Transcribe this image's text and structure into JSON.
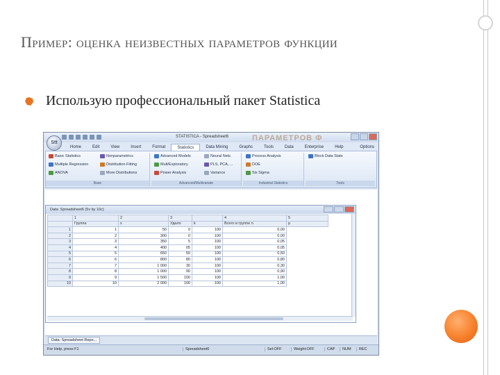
{
  "slide": {
    "title": "Пример: оценка неизвестных параметров функции",
    "bullet": "Использую профессиональный пакет Statistica"
  },
  "app": {
    "window_title": "STATISTICA - Spreadsheet6",
    "watermark": "ПАРАМЕТРОВ Ф",
    "orb_label": "Stt",
    "tabs": [
      "Home",
      "Edit",
      "View",
      "Insert",
      "Format",
      "Statistics",
      "Data Mining",
      "Graphs",
      "Tools",
      "Data",
      "Enterprise",
      "Help"
    ],
    "active_tab": "Statistics",
    "options_label": "Options",
    "ribbon": {
      "basic": [
        "Basic Statistics",
        "Multiple Regression",
        "ANOVA"
      ],
      "basic2": [
        "Nonparametrics",
        "Distribution Fitting",
        "More Distributions"
      ],
      "basic_label": "Base",
      "advanced": [
        "Advanced Models",
        "Mult/Exploratory",
        "Power Analysis"
      ],
      "advanced2": [
        "Neural Nets",
        "PLS, PCA, ...",
        "Variance"
      ],
      "advanced_label": "Advanced/Multivariate",
      "industrial": [
        "Process Analysis",
        "DOE",
        "Six Sigma"
      ],
      "industrial_label": "Industrial Statistics",
      "tools": [
        "Block Data Stats"
      ],
      "tools_label": "Tools"
    },
    "doc_title": "Data: Spreadsheet6 (5v by 10c)",
    "columns": [
      {
        "num": "1",
        "name": "Группа"
      },
      {
        "num": "2",
        "name": "x"
      },
      {
        "num": "3",
        "name": "Удало"
      },
      {
        "num": "k",
        "name": "k"
      },
      {
        "num": "4",
        "name": "Всего в группе   n"
      },
      {
        "num": "5",
        "name": "p"
      }
    ],
    "rows": [
      [
        "1",
        "1",
        "50",
        "0",
        "100",
        "0,00"
      ],
      [
        "2",
        "2",
        "300",
        "0",
        "100",
        "0,00"
      ],
      [
        "3",
        "3",
        "350",
        "5",
        "100",
        "0,05"
      ],
      [
        "4",
        "4",
        "400",
        "05",
        "100",
        "0,05"
      ],
      [
        "5",
        "5",
        "650",
        "50",
        "100",
        "0,50"
      ],
      [
        "6",
        "6",
        "800",
        "80",
        "100",
        "0,80"
      ],
      [
        "7",
        "7",
        "1 000",
        "30",
        "100",
        "0,30"
      ],
      [
        "8",
        "8",
        "1 000",
        "90",
        "100",
        "0,90"
      ],
      [
        "9",
        "9",
        "1 500",
        "100",
        "100",
        "1,00"
      ],
      [
        "10",
        "10",
        "2 000",
        "100",
        "100",
        "1,00"
      ]
    ],
    "task_item": "Data: Spreadsheet Repo...",
    "status": {
      "help": "For Help, press F1",
      "sheet": "Spreadsheet6",
      "sel": "Sel:OFF",
      "weight": "Weight:OFF",
      "cap": "CAP",
      "num": "NUM",
      "rec": "REC"
    }
  },
  "colors": {
    "accent": "#f6812b",
    "title": "#555555"
  }
}
